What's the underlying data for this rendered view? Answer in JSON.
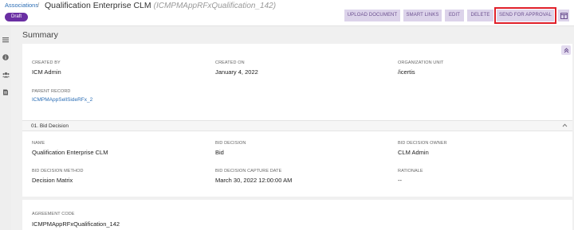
{
  "header": {
    "breadcrumb_link": "Associations",
    "breadcrumb_sep": "/",
    "title": "Qualification Enterprise CLM",
    "record_id": "(ICMPMAppRFxQualification_142)",
    "status": "Draft"
  },
  "toolbar": {
    "upload_document": "UPLOAD DOCUMENT",
    "smart_links": "SMART LINKS",
    "edit": "EDIT",
    "delete": "DELETE",
    "send_for_approval": "SEND FOR APPROVAL"
  },
  "summary": {
    "title": "Summary",
    "created_by_label": "CREATED BY",
    "created_by": "ICM Admin",
    "created_on_label": "CREATED ON",
    "created_on": "January 4, 2022",
    "org_unit_label": "ORGANIZATION UNIT",
    "org_unit": "/icertis",
    "parent_record_label": "PARENT RECORD",
    "parent_record": "ICMPMAppSellSideRFx_2"
  },
  "bid_decision": {
    "section_label": "01. Bid Decision",
    "name_label": "NAME",
    "name": "Qualification Enterprise CLM",
    "bid_decision_label": "BID DECISION",
    "bid_decision": "Bid",
    "owner_label": "BID DECISION OWNER",
    "owner": "CLM Admin",
    "method_label": "BID DECISION METHOD",
    "method": "Decision Matrix",
    "capture_date_label": "BID DECISION CAPTURE DATE",
    "capture_date": "March 30, 2022 12:00:00 AM",
    "rationale_label": "RATIONALE",
    "rationale": "--"
  },
  "agreement": {
    "code_label": "AGREEMENT CODE",
    "code": "ICMPMAppRFxQualification_142"
  },
  "colors": {
    "accent": "#6a2fa3",
    "button_bg": "#dcd3ea",
    "highlight": "#e0202a",
    "link": "#2a6db5"
  },
  "icons": [
    "menu-icon",
    "info-icon",
    "users-icon",
    "document-icon",
    "layout-icon",
    "collapse-up-icon",
    "chevron-up-icon"
  ]
}
